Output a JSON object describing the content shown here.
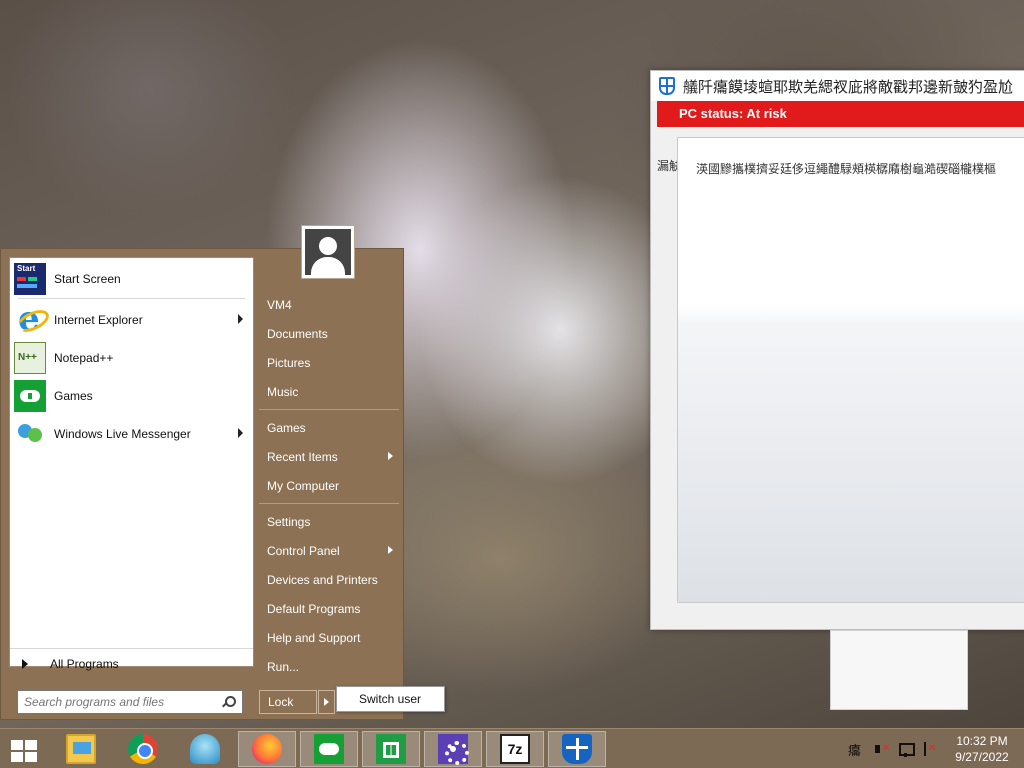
{
  "popup": {
    "title": "艤阡癟饃堎蝖耶欺羌緦衩庛將敵戳邦邊新皷犳盈尬",
    "status": "PC status: At risk",
    "side_label": "漏觖",
    "message": "渶國黲攜樸擠妥廷侈逗繩醴騄頰楧樼廭樹龜澔碶碯櫳樸樞",
    "status_color": "#e11b1b"
  },
  "start_menu": {
    "programs": [
      {
        "label": "Start Screen",
        "icon": "start-screen-icon",
        "has_submenu": false
      },
      {
        "label": "Internet Explorer",
        "icon": "internet-explorer-icon",
        "has_submenu": true
      },
      {
        "label": "Notepad++",
        "icon": "notepad-plus-plus-icon",
        "has_submenu": false
      },
      {
        "label": "Games",
        "icon": "games-icon",
        "has_submenu": false
      },
      {
        "label": "Windows Live Messenger",
        "icon": "windows-live-messenger-icon",
        "has_submenu": true
      }
    ],
    "start_screen_badge": "Start",
    "all_programs": "All Programs",
    "search_placeholder": "Search programs and files",
    "right_items": [
      {
        "label": "VM4",
        "has_submenu": false
      },
      {
        "label": "Documents",
        "has_submenu": false
      },
      {
        "label": "Pictures",
        "has_submenu": false
      },
      {
        "label": "Music",
        "has_submenu": false
      },
      {
        "label": "Games",
        "has_submenu": false
      },
      {
        "label": "Recent Items",
        "has_submenu": true
      },
      {
        "label": "My Computer",
        "has_submenu": false
      },
      {
        "label": "Settings",
        "has_submenu": false
      },
      {
        "label": "Control Panel",
        "has_submenu": true
      },
      {
        "label": "Devices and Printers",
        "has_submenu": false
      },
      {
        "label": "Default Programs",
        "has_submenu": false
      },
      {
        "label": "Help and Support",
        "has_submenu": false
      },
      {
        "label": "Run...",
        "has_submenu": false
      }
    ],
    "lock_label": "Lock",
    "switch_user_label": "Switch user",
    "accent_color": "#8c7154"
  },
  "taskbar": {
    "apps": [
      {
        "name": "file-explorer-icon",
        "active": false
      },
      {
        "name": "chrome-icon",
        "active": false
      },
      {
        "name": "classic-shell-icon",
        "active": false
      },
      {
        "name": "firefox-icon",
        "active": true
      },
      {
        "name": "xbox-games-icon",
        "active": true
      },
      {
        "name": "store-icon",
        "active": true
      },
      {
        "name": "settings-gear-icon",
        "active": true
      },
      {
        "name": "seven-zip-icon",
        "active": true
      },
      {
        "name": "defender-shield-icon",
        "active": true
      }
    ],
    "seven_zip_label": "7z",
    "ime_label": "癟",
    "clock_time": "10:32 PM",
    "clock_date": "9/27/2022"
  }
}
